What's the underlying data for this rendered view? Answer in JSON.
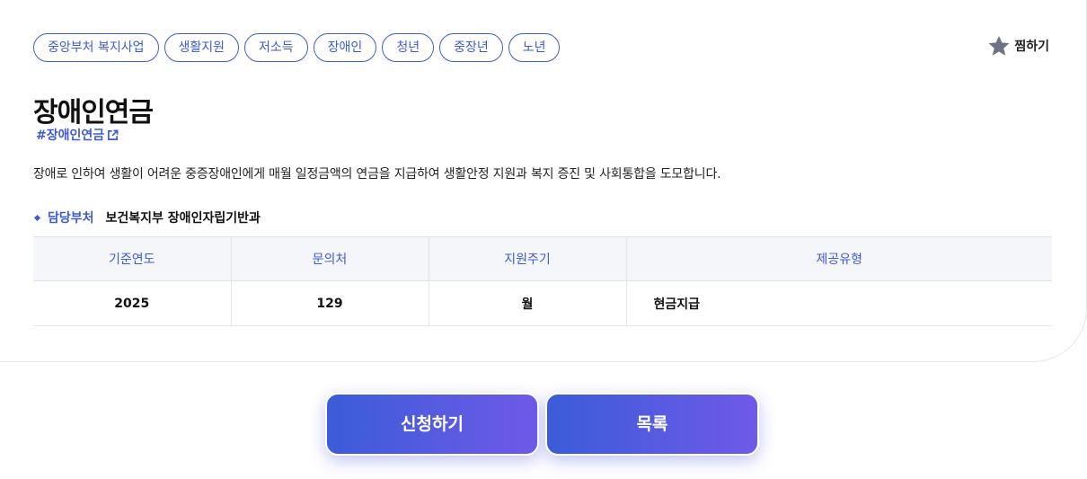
{
  "tags": [
    "중앙부처 복지사업",
    "생활지원",
    "저소득",
    "장애인",
    "청년",
    "중장년",
    "노년"
  ],
  "bookmark": {
    "label": "찜하기",
    "icon": "star-icon"
  },
  "title": "장애인연금",
  "hashtag": "#장애인연금",
  "description": "장애로 인하여 생활이 어려운 중증장애인에게 매월 일정금액의 연금을 지급하여 생활안정 지원과 복지 증진 및 사회통합을 도모합니다.",
  "department": {
    "label": "담당부처",
    "value": "보건복지부 장애인자립기반과"
  },
  "table": {
    "headers": [
      "기준연도",
      "문의처",
      "지원주기",
      "제공유형"
    ],
    "row": [
      "2025",
      "129",
      "월",
      "현금지급"
    ]
  },
  "buttons": {
    "apply": "신청하기",
    "list": "목록"
  },
  "colors": {
    "accent": "#3d5bd8",
    "button_start": "#3b5cd8",
    "button_end": "#6f5ae8"
  }
}
